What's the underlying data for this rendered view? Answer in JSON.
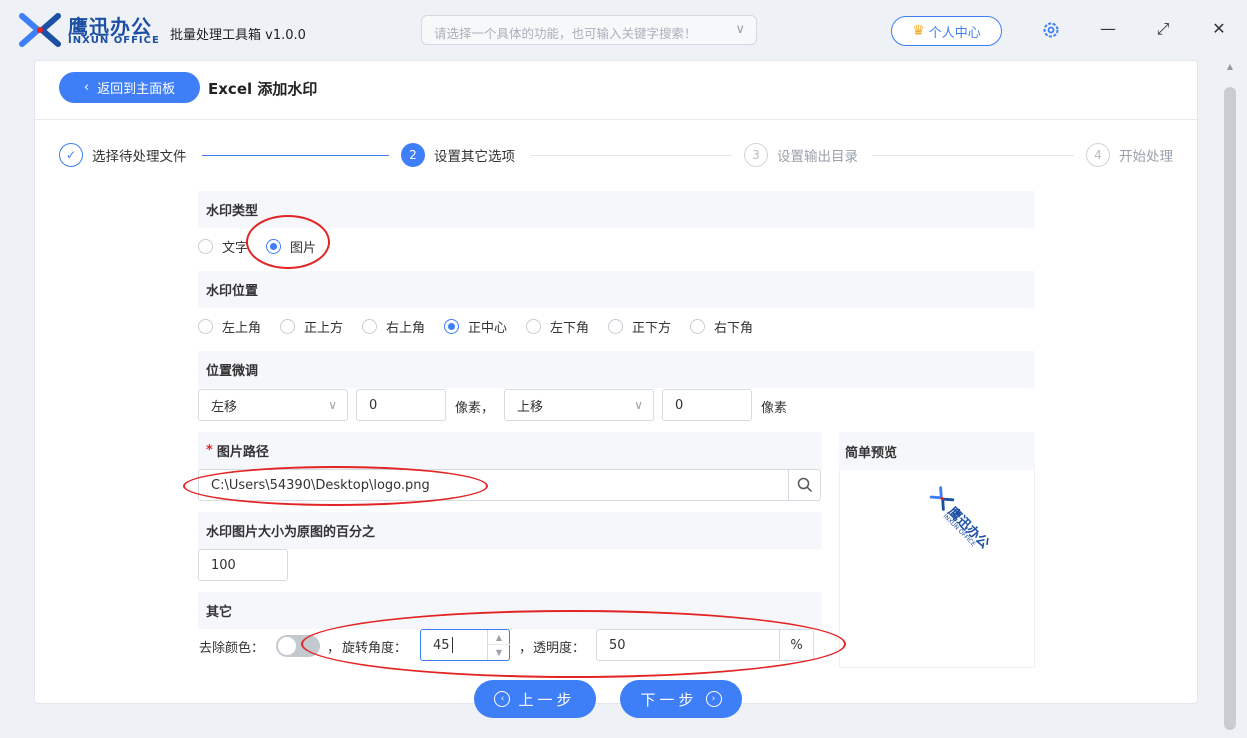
{
  "app": {
    "brand_cn": "鹰迅办公",
    "brand_en": "INXUN OFFICE",
    "title": "批量处理工具箱 v1.0.0",
    "search_placeholder": "请选择一个具体的功能，也可输入关键字搜索！",
    "user_center": "个人中心"
  },
  "header": {
    "back_label": "返回到主面板",
    "page_title": "Excel 添加水印"
  },
  "steps": [
    {
      "num": "✓",
      "label": "选择待处理文件",
      "state": "done"
    },
    {
      "num": "2",
      "label": "设置其它选项",
      "state": "active"
    },
    {
      "num": "3",
      "label": "设置输出目录",
      "state": "todo"
    },
    {
      "num": "4",
      "label": "开始处理",
      "state": "todo"
    }
  ],
  "watermark_type": {
    "title": "水印类型",
    "options": [
      {
        "label": "文字",
        "selected": false
      },
      {
        "label": "图片",
        "selected": true
      }
    ]
  },
  "watermark_position": {
    "title": "水印位置",
    "options": [
      {
        "label": "左上角",
        "selected": false
      },
      {
        "label": "正上方",
        "selected": false
      },
      {
        "label": "右上角",
        "selected": false
      },
      {
        "label": "正中心",
        "selected": true
      },
      {
        "label": "左下角",
        "selected": false
      },
      {
        "label": "正下方",
        "selected": false
      },
      {
        "label": "右下角",
        "selected": false
      }
    ]
  },
  "fine_tune": {
    "title": "位置微调",
    "h_dir": "左移",
    "h_value": "0",
    "h_unit": "像素，",
    "v_dir": "上移",
    "v_value": "0",
    "v_unit": "像素"
  },
  "image_path": {
    "required_mark": "*",
    "title": "图片路径",
    "value": "C:\\Users\\54390\\Desktop\\logo.png"
  },
  "image_size": {
    "title": "水印图片大小为原图的百分之",
    "value": "100"
  },
  "preview": {
    "title": "简单预览",
    "logo_cn": "鹰迅办公",
    "logo_en": "INXUN OFFICE"
  },
  "others": {
    "title": "其它",
    "remove_color_label": "去除颜色：",
    "remove_color_on": false,
    "sep1": "，",
    "rotate_label": "旋转角度：",
    "rotate_value": "45",
    "sep2": "，",
    "opacity_label": "透明度：",
    "opacity_value": "50",
    "opacity_unit": "%"
  },
  "nav": {
    "prev_label": "上一步",
    "next_label": "下一步"
  },
  "colors": {
    "accent": "#3e7ef7",
    "annotation": "#e32424"
  }
}
